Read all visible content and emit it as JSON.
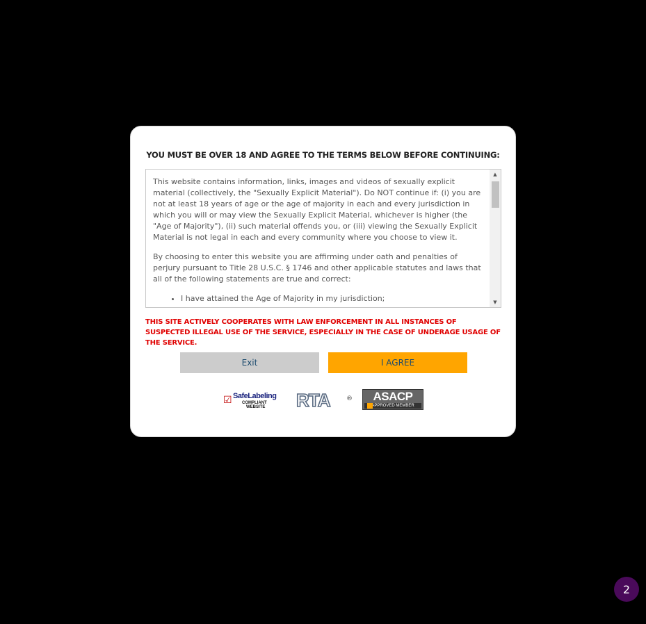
{
  "modal": {
    "title": "YOU MUST BE OVER 18 AND AGREE TO THE TERMS BELOW BEFORE CONTINUING:",
    "terms": {
      "paragraph1": "This website contains information, links, images and videos of sexually explicit material (collectively, the \"Sexually Explicit Material\"). Do NOT continue if: (i) you are not at least 18 years of age or the age of majority in each and every jurisdiction in which you will or may view the Sexually Explicit Material, whichever is higher (the \"Age of Majority\"), (ii) such material offends you, or (iii) viewing the Sexually Explicit Material is not legal in each and every community where you choose to view it.",
      "paragraph2": "By choosing to enter this website you are affirming under oath and penalties of perjury pursuant to Title 28 U.S.C. § 1746 and other applicable statutes and laws that all of the following statements are true and correct:",
      "list": [
        "I have attained the Age of Majority in my jurisdiction;"
      ],
      "scroll_position": 0.05
    },
    "warning": "THIS SITE ACTIVELY COOPERATES WITH LAW ENFORCEMENT IN ALL INSTANCES OF SUSPECTED ILLEGAL USE OF THE SERVICE, ESPECIALLY IN THE CASE OF UNDERAGE USAGE OF THE SERVICE.",
    "buttons": {
      "exit_label": "Exit",
      "agree_label": "I AGREE"
    },
    "logos": {
      "safelabeling": {
        "main": "SafeLabeling",
        "line1": "COMPLIANT",
        "line2": "WEBSITE"
      },
      "rta": {
        "text": "RTA",
        "mark": "®"
      },
      "asacp": {
        "main": "ASACP",
        "sub": "APPROVED MEMBER"
      }
    }
  },
  "notification_badge": {
    "count": "2"
  },
  "colors": {
    "background": "#000000",
    "agree_button": "#ffa500",
    "exit_button": "#cccccc",
    "warning_text": "#e00000",
    "badge": "#4a0a5a"
  }
}
